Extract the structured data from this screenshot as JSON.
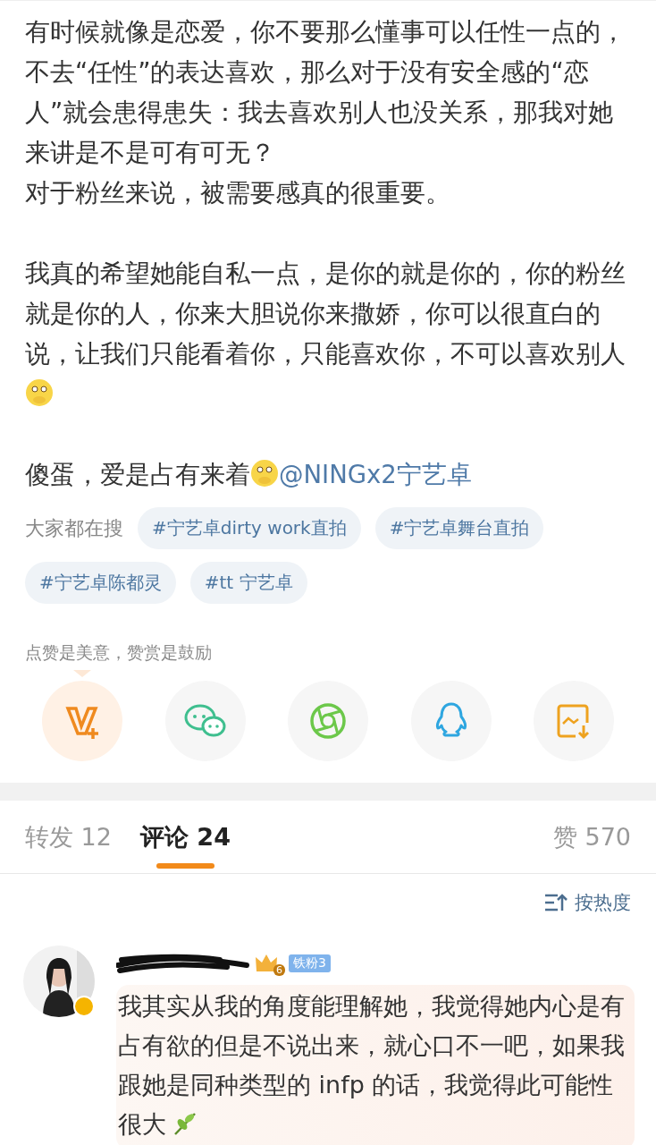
{
  "post": {
    "paragraphs": [
      [
        {
          "kind": "text",
          "text": "有时候就像是恋爱，你不要那么懂事可以任性一点的，不去“任性”的表达喜欢，那么对于没有安全感的“恋人”就会患得患失：我去喜欢别人也没关系，那我对她来讲是不是可有可无？"
        }
      ],
      [
        {
          "kind": "text",
          "text": "对于粉丝来说，被需要感真的很重要。"
        }
      ],
      [
        {
          "kind": "text",
          "text": "我真的希望她能自私一点，是你的就是你的，你的粉丝就是你的人，你来大胆说你来撒娇，你可以很直白的说，让我们只能看着你，只能喜欢你，不可以喜欢别人"
        },
        {
          "kind": "emoji"
        }
      ],
      [
        {
          "kind": "text",
          "text": "傻蛋，爱是占有来着"
        },
        {
          "kind": "emoji"
        },
        {
          "kind": "mention",
          "text": "@NINGx2宁艺卓"
        }
      ]
    ]
  },
  "hot_search": {
    "label": "大家都在搜",
    "tags": [
      "#宁艺卓dirty work直拍",
      "#宁艺卓舞台直拍",
      "#宁艺卓陈都灵",
      "#tt 宁艺卓"
    ]
  },
  "reward_hint": "点赞是美意，赞赏是鼓励",
  "share_buttons": [
    {
      "kind": "vplus",
      "highlighted": true
    },
    {
      "kind": "wechat",
      "highlighted": false
    },
    {
      "kind": "moments",
      "highlighted": false
    },
    {
      "kind": "qq",
      "highlighted": false
    },
    {
      "kind": "save-image",
      "highlighted": false
    }
  ],
  "tabs": [
    {
      "label": "转发 12",
      "selected": false
    },
    {
      "label": "评论 24",
      "selected": true
    },
    {
      "label": "赞 570",
      "selected": false
    }
  ],
  "sort": {
    "label": "按热度"
  },
  "comments": [
    {
      "name_redacted": true,
      "verified": true,
      "crown_level": "6",
      "fan_badge": "铁粉3",
      "text": "我其实从我的角度能理解她，我觉得她内心是有占有欲的但是不说出来，就心口不一吧，如果我跟她是同种类型的 infp 的话，我觉得此可能性很大",
      "plant_emoji": true
    }
  ]
}
